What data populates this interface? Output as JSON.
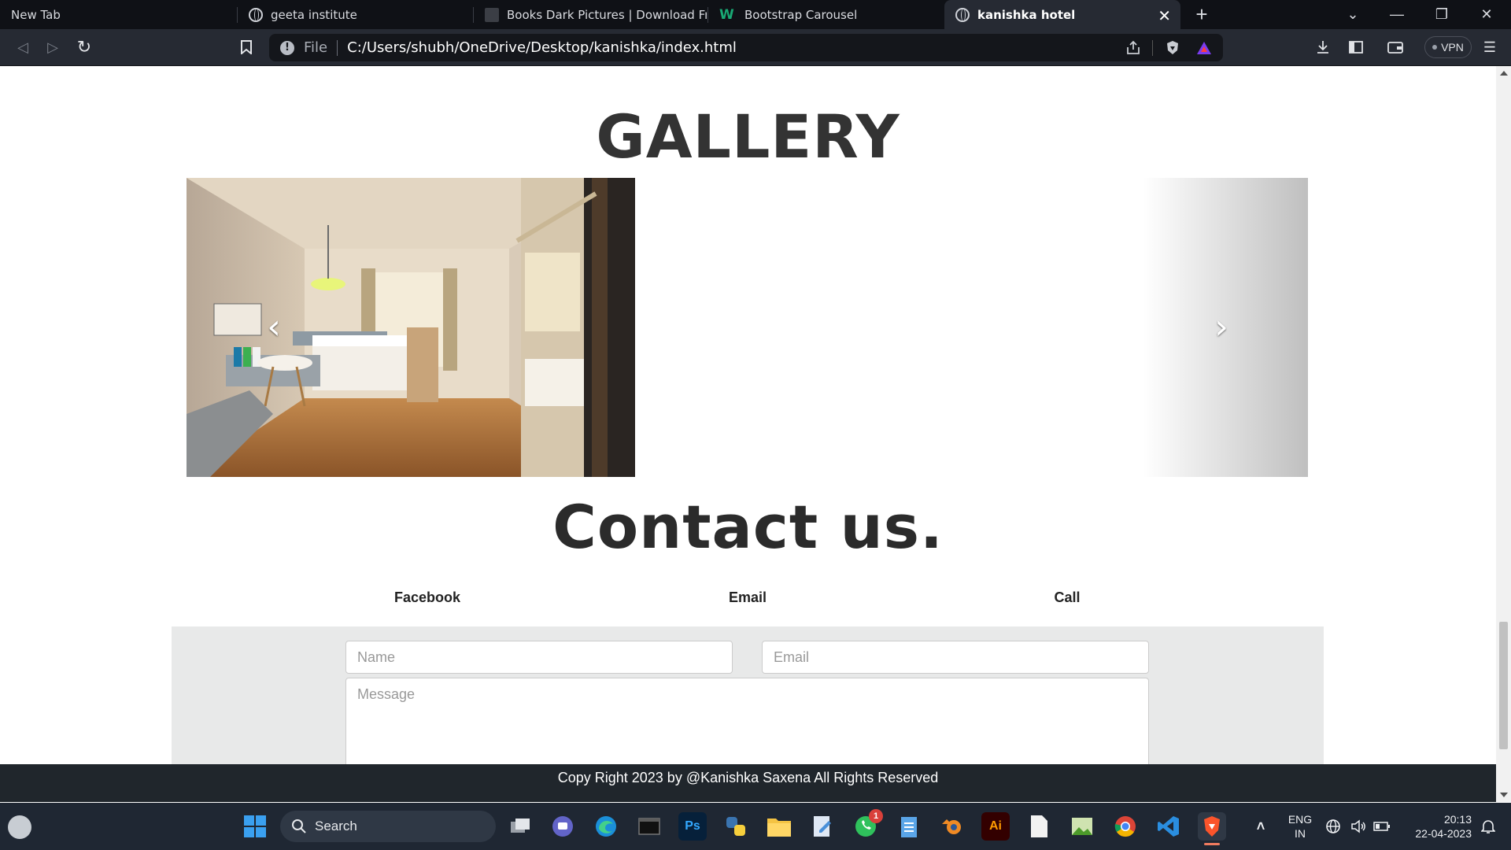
{
  "browser": {
    "tabs": [
      {
        "title": "New Tab",
        "icon": "none"
      },
      {
        "title": "geeta institute",
        "icon": "globe-icon"
      },
      {
        "title": "Books Dark Pictures | Download Free I",
        "icon": "image-site-icon"
      },
      {
        "title": "Bootstrap Carousel",
        "icon": "w-logo-icon"
      },
      {
        "title": "kanishka hotel",
        "icon": "globe-icon",
        "active": true
      }
    ],
    "url_scheme": "File",
    "url": "C:/Users/shubh/OneDrive/Desktop/kanishka/index.html",
    "vpn_label": "VPN"
  },
  "page": {
    "gallery_title": "GALLERY",
    "carousel_prev": "‹",
    "carousel_next": "›",
    "contact_title": "Contact us.",
    "contact_links": [
      "Facebook",
      "Email",
      "Call"
    ],
    "form": {
      "name_placeholder": "Name",
      "email_placeholder": "Email",
      "message_placeholder": "Message"
    },
    "footer": "Copy Right 2023 by @Kanishka Saxena All Rights Reserved"
  },
  "taskbar": {
    "search_label": "Search",
    "whatsapp_badge": "1",
    "lang_line1": "ENG",
    "lang_line2": "IN",
    "time": "20:13",
    "date": "22-04-2023"
  }
}
